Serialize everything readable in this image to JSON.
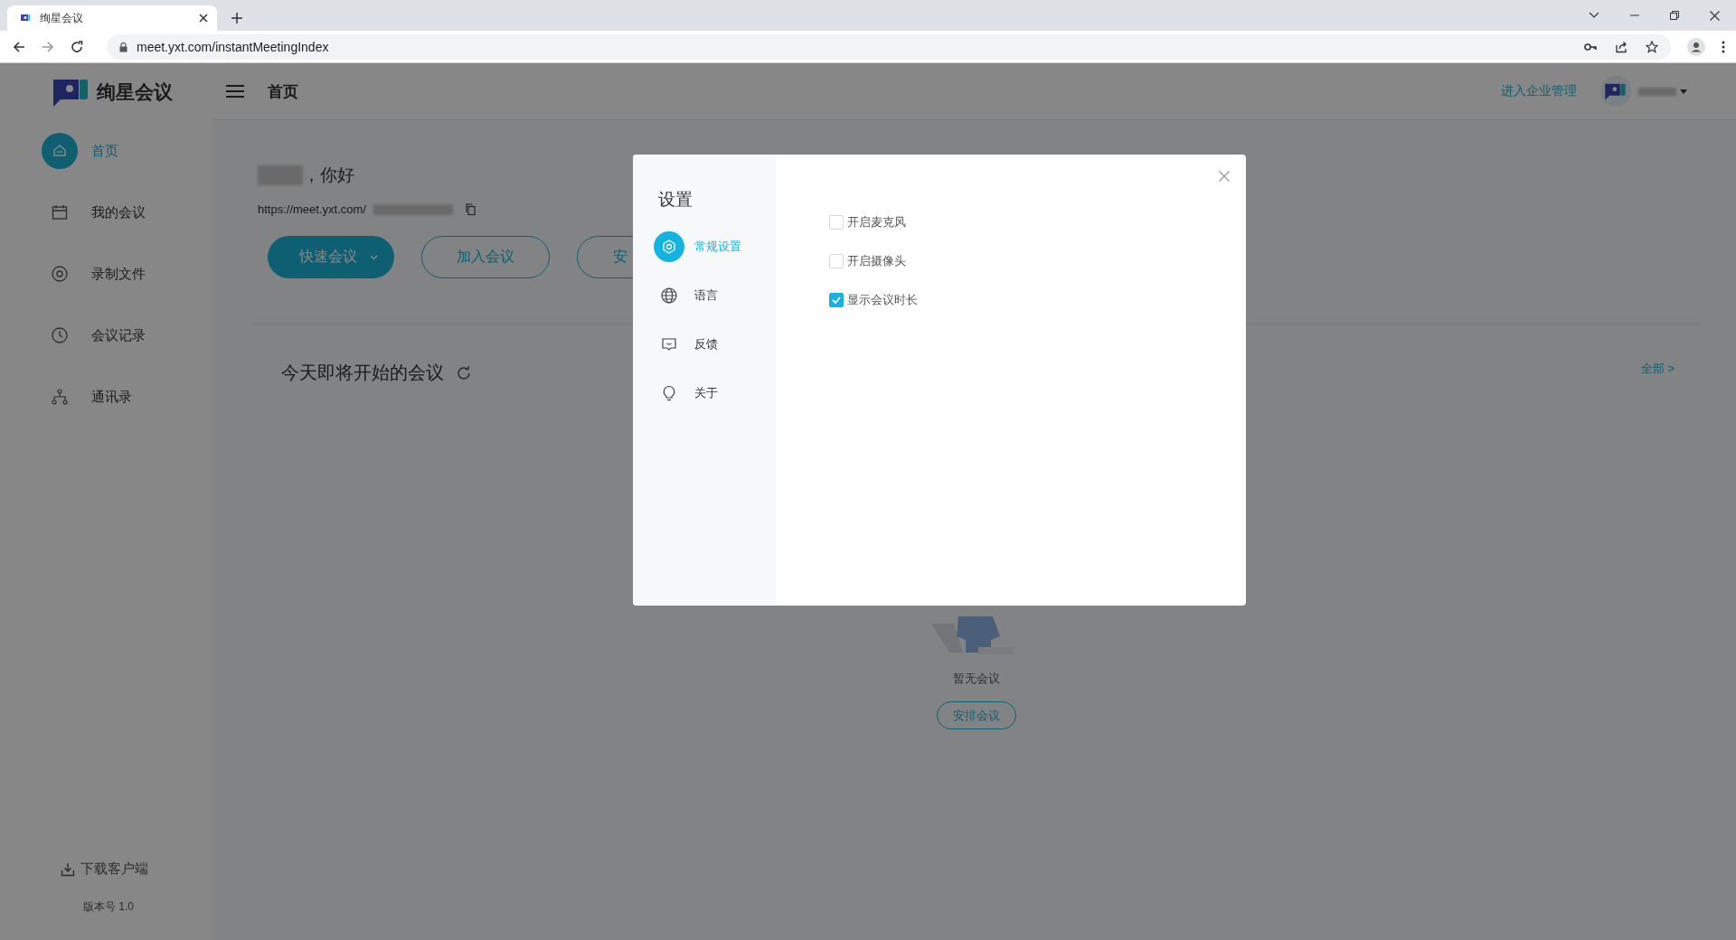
{
  "browser": {
    "tab": {
      "title": "绚星会议"
    },
    "address": "meet.yxt.com/instantMeetingIndex"
  },
  "app": {
    "logo_text": "绚星会议",
    "page_title": "首页",
    "admin_link": "进入企业管理"
  },
  "sidebar": {
    "items": [
      {
        "label": "首页",
        "selected": true
      },
      {
        "label": "我的会议",
        "selected": false
      },
      {
        "label": "录制文件",
        "selected": false
      },
      {
        "label": "会议记录",
        "selected": false
      },
      {
        "label": "通讯录",
        "selected": false
      }
    ],
    "download": "下载客户端",
    "version": "版本号 1.0"
  },
  "home": {
    "greeting": "，你好",
    "meeting_url": "https://meet.yxt.com/",
    "buttons": [
      {
        "label": "快速会议",
        "kind": "primary"
      },
      {
        "label": "加入会议",
        "kind": "outline"
      },
      {
        "label": "安",
        "kind": "outline"
      }
    ],
    "section_title": "今天即将开始的会议",
    "all_link": "全部 >",
    "empty_text": "暂无会议",
    "empty_button": "安排会议"
  },
  "settings": {
    "title": "设置",
    "nav": [
      {
        "label": "常规设置",
        "selected": true
      },
      {
        "label": "语言",
        "selected": false
      },
      {
        "label": "反馈",
        "selected": false
      },
      {
        "label": "关于",
        "selected": false
      }
    ],
    "options": [
      {
        "label": "开启麦克风",
        "checked": false
      },
      {
        "label": "开启摄像头",
        "checked": false
      },
      {
        "label": "显示会议时长",
        "checked": true
      }
    ]
  }
}
